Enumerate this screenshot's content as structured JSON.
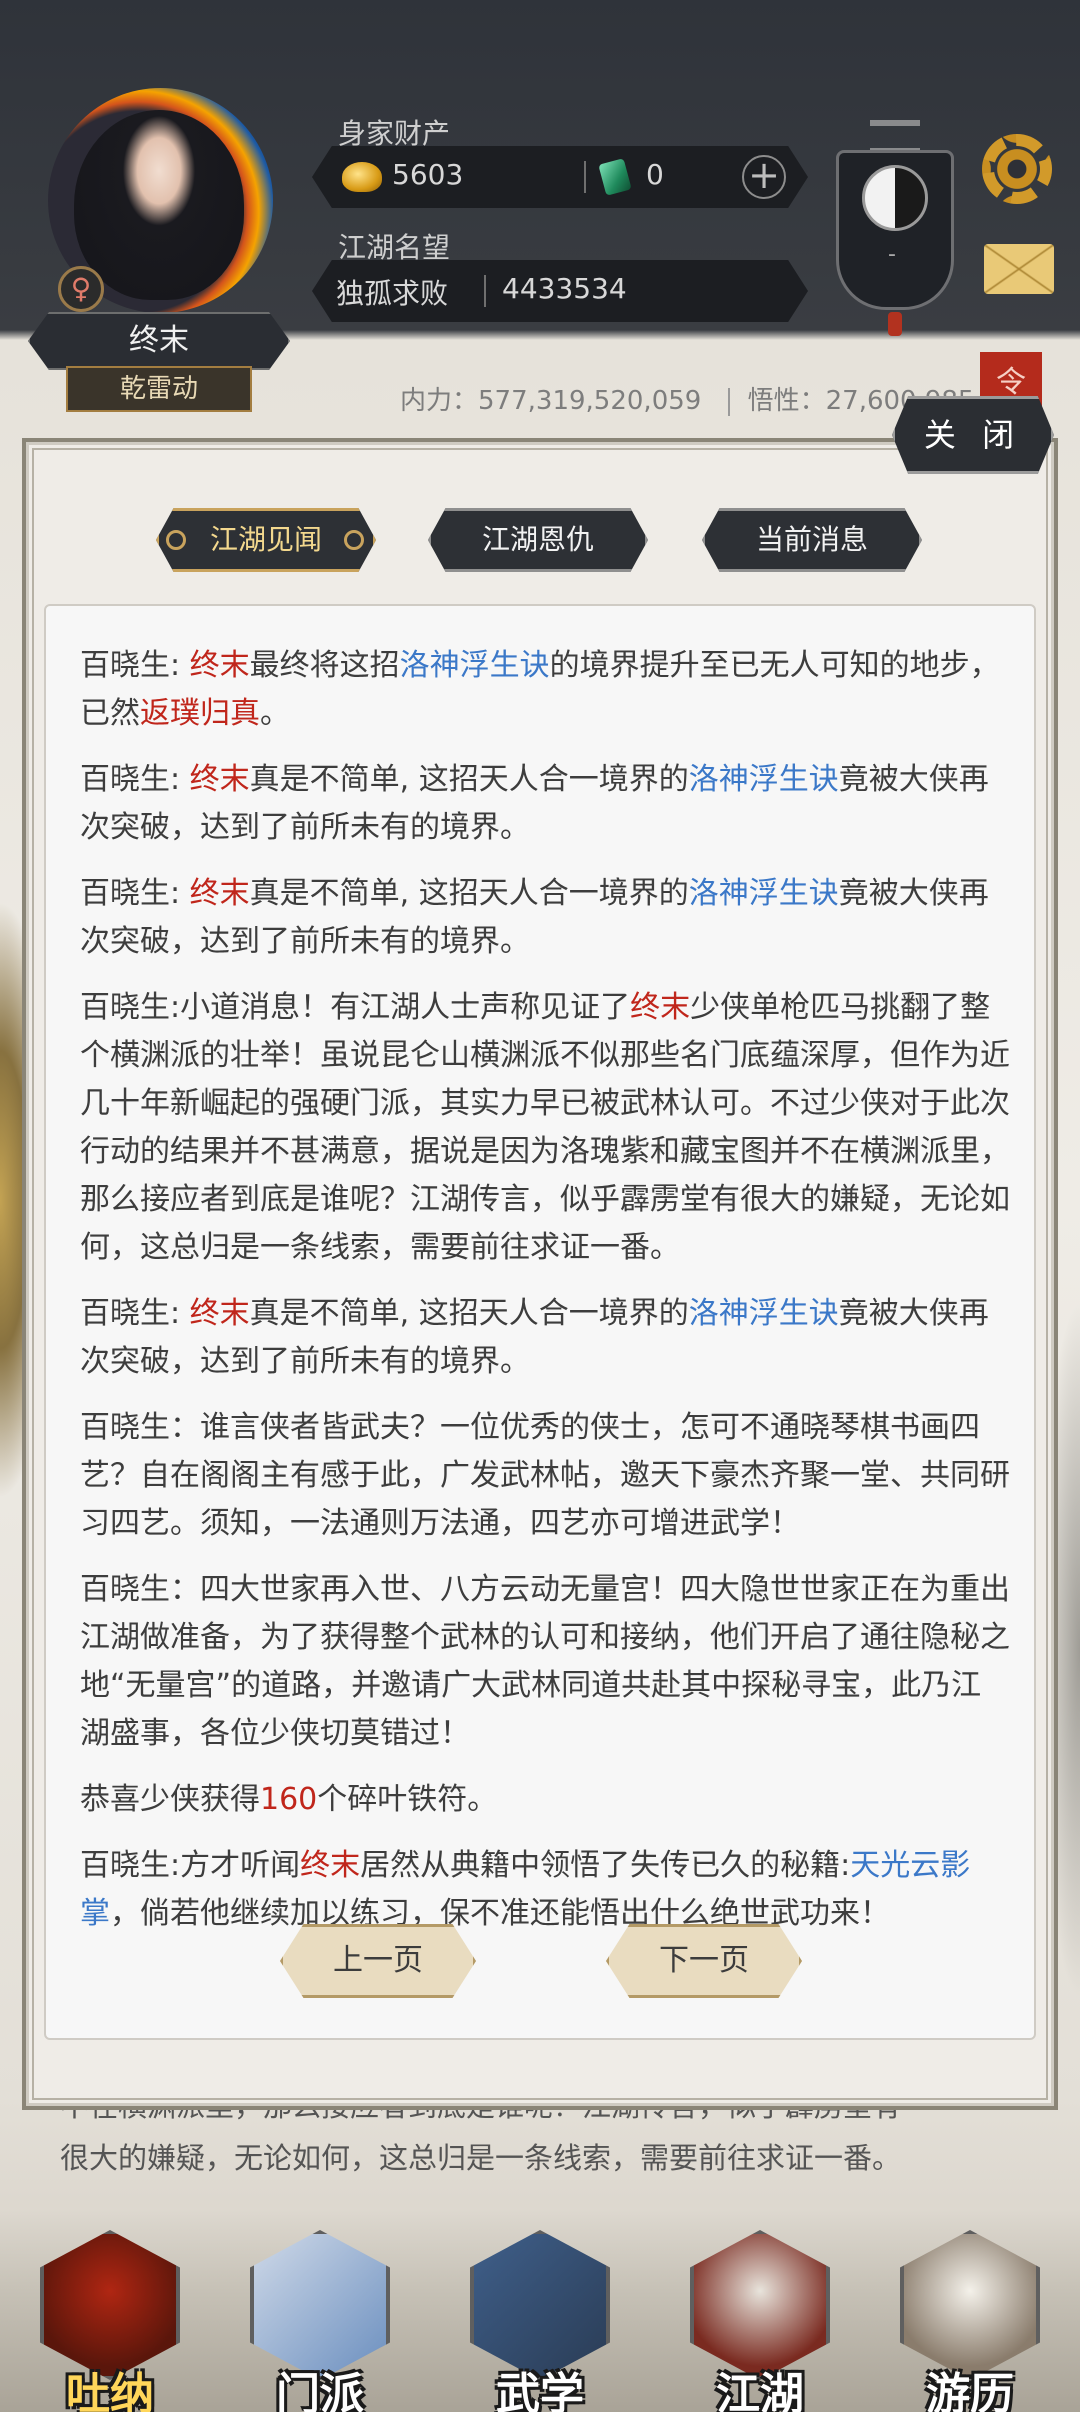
{
  "header": {
    "player_name": "终末",
    "sect_name": "乾雷动",
    "gender_symbol": "♀",
    "wealth_label": "身家财产",
    "gold": "5603",
    "jade": "0",
    "plus": "+",
    "fame_label": "江湖名望",
    "fame_title": "独孤求败",
    "fame_value": "4433534",
    "taiji_sub": "-",
    "inner_power_label": "内力：",
    "inner_power_value": "577,319,520,059",
    "insight_label": "悟性：",
    "insight_value": "27,600,985",
    "red_tag": "令"
  },
  "modal": {
    "close_label": "关 闭",
    "tabs": [
      {
        "label": "江湖见闻"
      },
      {
        "label": "江湖恩仇"
      },
      {
        "label": "当前消息"
      }
    ],
    "messages": [
      {
        "segments": [
          {
            "t": "百晓生: "
          },
          {
            "t": "终末",
            "c": "red"
          },
          {
            "t": "最终将这招"
          },
          {
            "t": "洛神浮生诀",
            "c": "blue"
          },
          {
            "t": "的境界提升至已无人可知的地步，已然"
          },
          {
            "t": "返璞归真",
            "c": "red"
          },
          {
            "t": "。"
          }
        ]
      },
      {
        "segments": [
          {
            "t": "百晓生: "
          },
          {
            "t": "终末",
            "c": "red"
          },
          {
            "t": "真是不简单, 这招天人合一境界的"
          },
          {
            "t": "洛神浮生诀",
            "c": "blue"
          },
          {
            "t": "竟被大侠再次突破，达到了前所未有的境界。"
          }
        ]
      },
      {
        "segments": [
          {
            "t": "百晓生: "
          },
          {
            "t": "终末",
            "c": "red"
          },
          {
            "t": "真是不简单, 这招天人合一境界的"
          },
          {
            "t": "洛神浮生诀",
            "c": "blue"
          },
          {
            "t": "竟被大侠再次突破，达到了前所未有的境界。"
          }
        ]
      },
      {
        "segments": [
          {
            "t": "百晓生:小道消息！有江湖人士声称见证了"
          },
          {
            "t": "终末",
            "c": "red"
          },
          {
            "t": "少侠单枪匹马挑翻了整个横渊派的壮举！虽说昆仑山横渊派不似那些名门底蕴深厚，但作为近几十年新崛起的强硬门派，其实力早已被武林认可。不过少侠对于此次行动的结果并不甚满意，据说是因为洛瑰紫和藏宝图并不在横渊派里，那么接应者到底是谁呢？江湖传言，似乎霹雳堂有很大的嫌疑，无论如何，这总归是一条线索，需要前往求证一番。"
          }
        ]
      },
      {
        "segments": [
          {
            "t": "百晓生: "
          },
          {
            "t": "终末",
            "c": "red"
          },
          {
            "t": "真是不简单, 这招天人合一境界的"
          },
          {
            "t": "洛神浮生诀",
            "c": "blue"
          },
          {
            "t": "竟被大侠再次突破，达到了前所未有的境界。"
          }
        ]
      },
      {
        "segments": [
          {
            "t": "百晓生：谁言侠者皆武夫？一位优秀的侠士，怎可不通晓琴棋书画四艺？自在阁阁主有感于此，广发武林帖，邀天下豪杰齐聚一堂、共同研习四艺。须知，一法通则万法通，四艺亦可增进武学！"
          }
        ]
      },
      {
        "segments": [
          {
            "t": "百晓生：四大世家再入世、八方云动无量宫！四大隐世世家正在为重出江湖做准备，为了获得整个武林的认可和接纳，他们开启了通往隐秘之地“无量宫”的道路，并邀请广大武林同道共赴其中探秘寻宝，此乃江湖盛事，各位少侠切莫错过！"
          }
        ]
      },
      {
        "segments": [
          {
            "t": "恭喜少侠获得"
          },
          {
            "t": "160",
            "c": "red"
          },
          {
            "t": "个碎叶铁符。"
          }
        ]
      },
      {
        "segments": [
          {
            "t": "百晓生:方才听闻"
          },
          {
            "t": "终末",
            "c": "red"
          },
          {
            "t": "居然从典籍中领悟了失传已久的秘籍:"
          },
          {
            "t": "天光云影掌",
            "c": "blue"
          },
          {
            "t": "，倘若他继续加以练习，保不准还能悟出什么绝世武功来！"
          }
        ]
      }
    ],
    "prev_page": "上一页",
    "next_page": "下一页"
  },
  "background_text": {
    "line2": "不在横渊派里，那么接应者到底是谁呢？江湖传言，似乎霹雳堂有",
    "line3": "很大的嫌疑，无论如何，这总归是一条线索，需要前往求证一番。"
  },
  "nav": [
    {
      "label": "吐纳",
      "icon": "meditation-icon"
    },
    {
      "label": "门派",
      "icon": "sect-icon"
    },
    {
      "label": "武学",
      "icon": "martial-arts-icon"
    },
    {
      "label": "江湖",
      "icon": "jianghu-icon"
    },
    {
      "label": "游历",
      "icon": "travel-icon"
    }
  ],
  "colors": {
    "highlight_red": "#c0261b",
    "highlight_blue": "#3b78c8",
    "gold_accent": "#c9a35d"
  }
}
